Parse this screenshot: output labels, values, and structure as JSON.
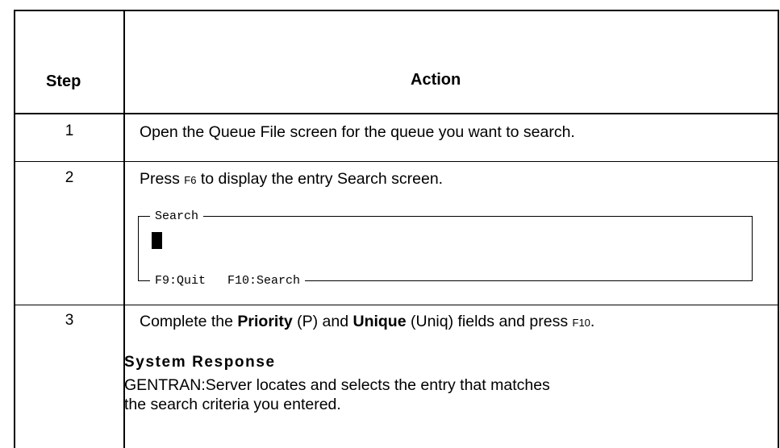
{
  "table": {
    "header": {
      "step": "Step",
      "action": "Action"
    },
    "rows": [
      {
        "step": "1",
        "action": "Open the Queue File screen for the queue you want to search."
      },
      {
        "step": "2",
        "action_pre": "Press ",
        "action_key": "F6",
        "action_post": " to display the entry Search screen.",
        "screen": {
          "title": "Search",
          "keys": "F9:Quit   F10:Search"
        }
      },
      {
        "step": "3",
        "action_parts": {
          "p1": "Complete the ",
          "b1": "Priority",
          "p2": " (P) and ",
          "b2": "Unique",
          "p3": " (Uniq) fields and press ",
          "key": "F10",
          "p4": "."
        },
        "response_heading": "System Response",
        "response_line1": "GENTRAN:Server locates and selects the entry that matches",
        "response_line2": "the search criteria you entered."
      }
    ]
  }
}
